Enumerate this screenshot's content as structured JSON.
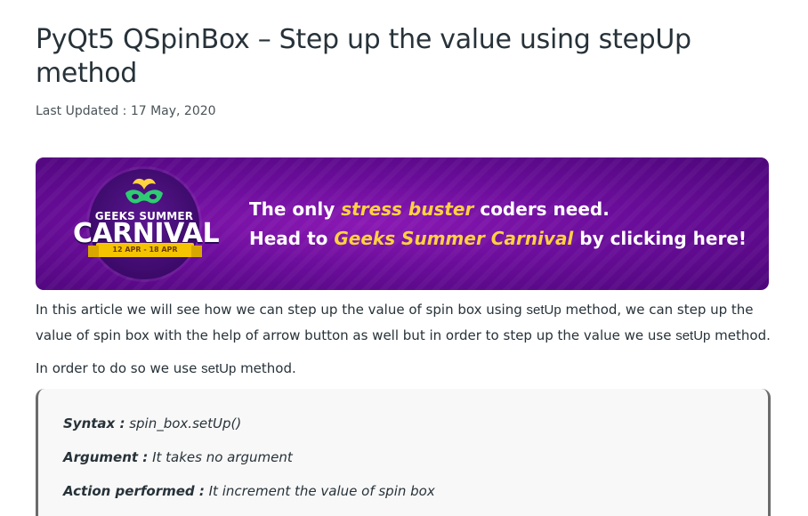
{
  "article": {
    "title": "PyQt5 QSpinBox – Step up the value using stepUp method",
    "last_updated": "Last Updated : 17 May, 2020"
  },
  "banner": {
    "badge_top": "GEEKS SUMMER",
    "badge_main": "CARNIVAL",
    "badge_dates": "12 APR - 18 APR",
    "line1_pre": "The only ",
    "line1_highlight": "stress buster",
    "line1_post": " coders need.",
    "line2_pre": "Head to ",
    "line2_highlight": "Geeks Summer Carnival",
    "line2_post": " by clicking here!",
    "colors": {
      "background": "#6b0d9b",
      "highlight": "#ffd23f"
    }
  },
  "content": {
    "p1_a": "In this article we will see how we can step up the value of spin box using ",
    "p1_code1": "setUp",
    "p1_b": " method, we can step up the value of spin box with the help of arrow button as well but in order to step up the value we use ",
    "p1_code2": "setUp",
    "p1_c": " method.",
    "p2_a": "In order to do so we use ",
    "p2_code": "setUp",
    "p2_b": " method."
  },
  "syntax": {
    "syntax_label": "Syntax :",
    "syntax_value": " spin_box.setUp()",
    "argument_label": "Argument :",
    "argument_value": " It takes no argument",
    "action_label": "Action performed :",
    "action_value": " It increment the value of spin box"
  }
}
